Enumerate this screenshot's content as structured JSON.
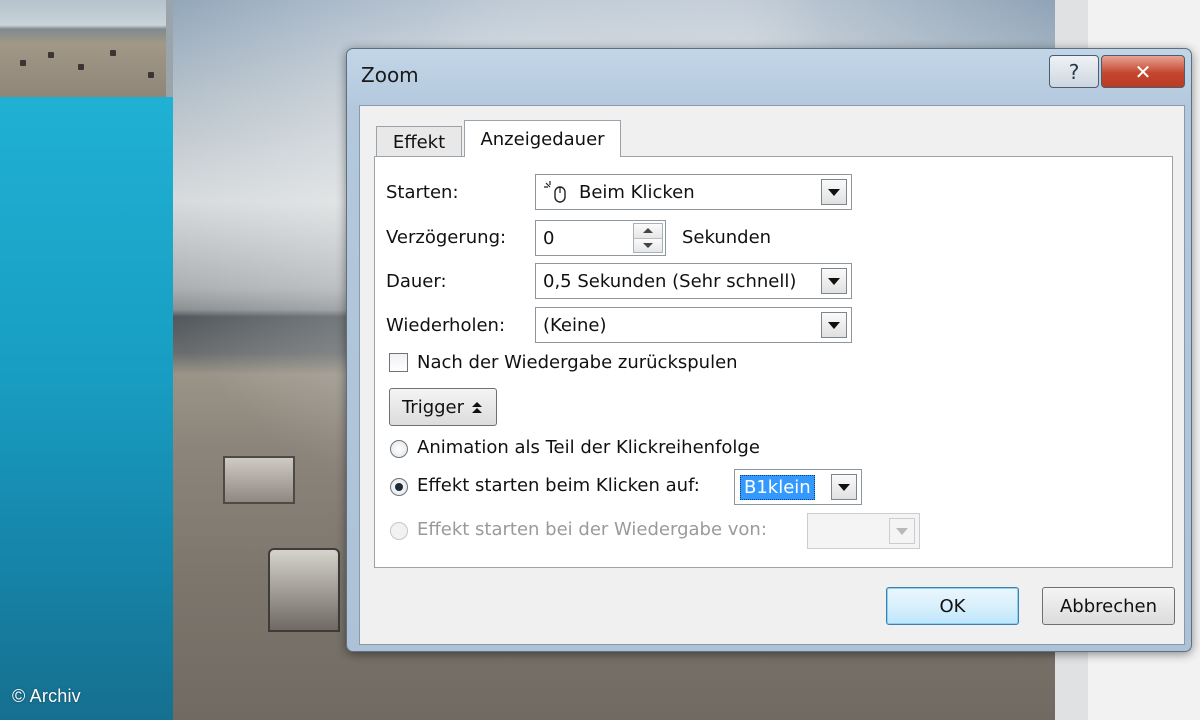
{
  "background": {
    "copyright": "© Archiv"
  },
  "dialog": {
    "title": "Zoom",
    "help_label": "?",
    "close_label": "✕",
    "tabs": [
      {
        "label": "Effekt",
        "active": false
      },
      {
        "label": "Anzeigedauer",
        "active": true
      }
    ],
    "fields": {
      "starten": {
        "label": "Starten:",
        "value": "Beim Klicken",
        "icon": "mouse-click-icon"
      },
      "verzoegerung": {
        "label": "Verzögerung:",
        "value": "0",
        "unit": "Sekunden"
      },
      "dauer": {
        "label": "Dauer:",
        "value": "0,5 Sekunden (Sehr schnell)"
      },
      "wiederholen": {
        "label": "Wiederholen:",
        "value": "(Keine)"
      }
    },
    "rewind_checkbox": {
      "label": "Nach der Wiedergabe zurückspulen",
      "checked": false
    },
    "trigger_button": {
      "label": "Trigger",
      "icon": "double-chevron-up-icon"
    },
    "trigger_options": [
      {
        "label": "Animation als Teil der Klickreihenfolge",
        "selected": false,
        "enabled": true
      },
      {
        "label": "Effekt starten beim Klicken auf:",
        "selected": true,
        "enabled": true,
        "value": "B1klein"
      },
      {
        "label": "Effekt starten bei der Wiedergabe von:",
        "selected": false,
        "enabled": false,
        "value": ""
      }
    ],
    "buttons": {
      "ok": "OK",
      "cancel": "Abbrechen"
    },
    "colors": {
      "close_red": "#c4462f",
      "frame_blue": "#b3c8dd",
      "selection_blue": "#3399ff"
    }
  }
}
